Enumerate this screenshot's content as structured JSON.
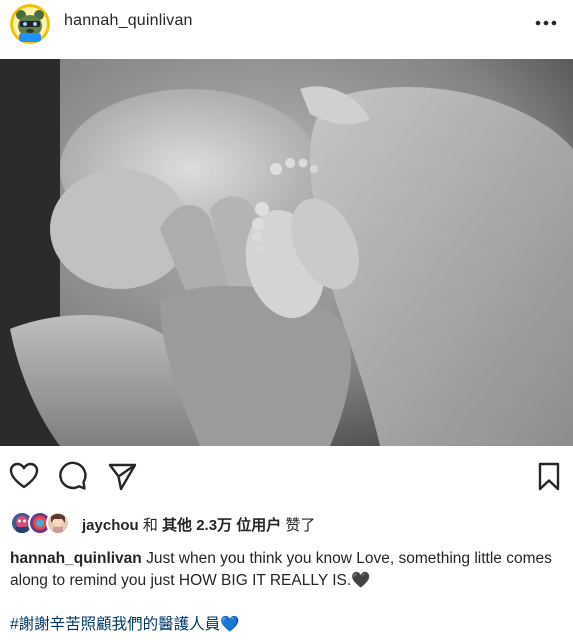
{
  "post": {
    "username": "hannah_quinlivan",
    "avatar_icon": "cartoon-bear-avatar-icon",
    "more_icon": "more-options-icon"
  },
  "photo": {
    "description_icon": "baby-feet-in-hands-photo"
  },
  "actions": {
    "like_icon": "heart-icon",
    "comment_icon": "comment-icon",
    "share_icon": "paper-plane-icon",
    "save_icon": "bookmark-icon"
  },
  "likes": {
    "user": "jaychou",
    "connector": "和",
    "others": "其他 2.3万 位用户",
    "suffix": "赞了"
  },
  "caption": {
    "username": "hannah_quinlivan",
    "text": " Just when you think you know Love, something little comes along to remind you just HOW BIG IT REALLY IS.",
    "emoji": "🖤",
    "hashtag": "#謝謝辛苦照顧我們的醫護人員",
    "hashtag_emoji": "💙"
  },
  "colors": {
    "text": "#262626",
    "hashtag": "#00376b"
  }
}
